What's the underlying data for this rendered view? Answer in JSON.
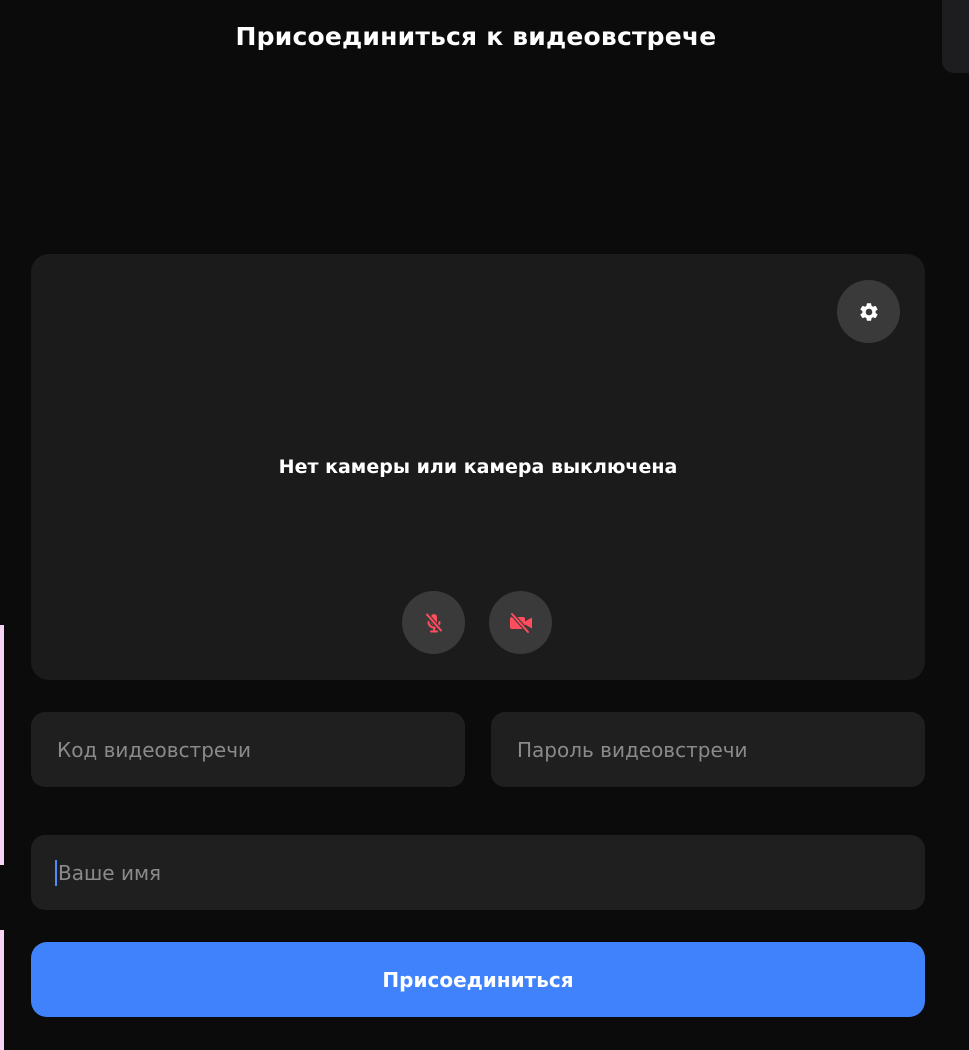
{
  "page": {
    "title": "Присоединиться к видеовстрече"
  },
  "preview": {
    "status_text": "Нет камеры или камера выключена",
    "settings_icon": "gear-icon",
    "mic_icon": "mic-off-icon",
    "camera_icon": "camera-off-icon",
    "muted_color": "#ff4d5e"
  },
  "form": {
    "meeting_code": {
      "value": "",
      "placeholder": "Код видеовстречи"
    },
    "meeting_password": {
      "value": "",
      "placeholder": "Пароль видеовстречи"
    },
    "your_name": {
      "value": "",
      "placeholder": "Ваше имя"
    }
  },
  "actions": {
    "join_label": "Присоединиться",
    "accent_color": "#3f82fb"
  }
}
